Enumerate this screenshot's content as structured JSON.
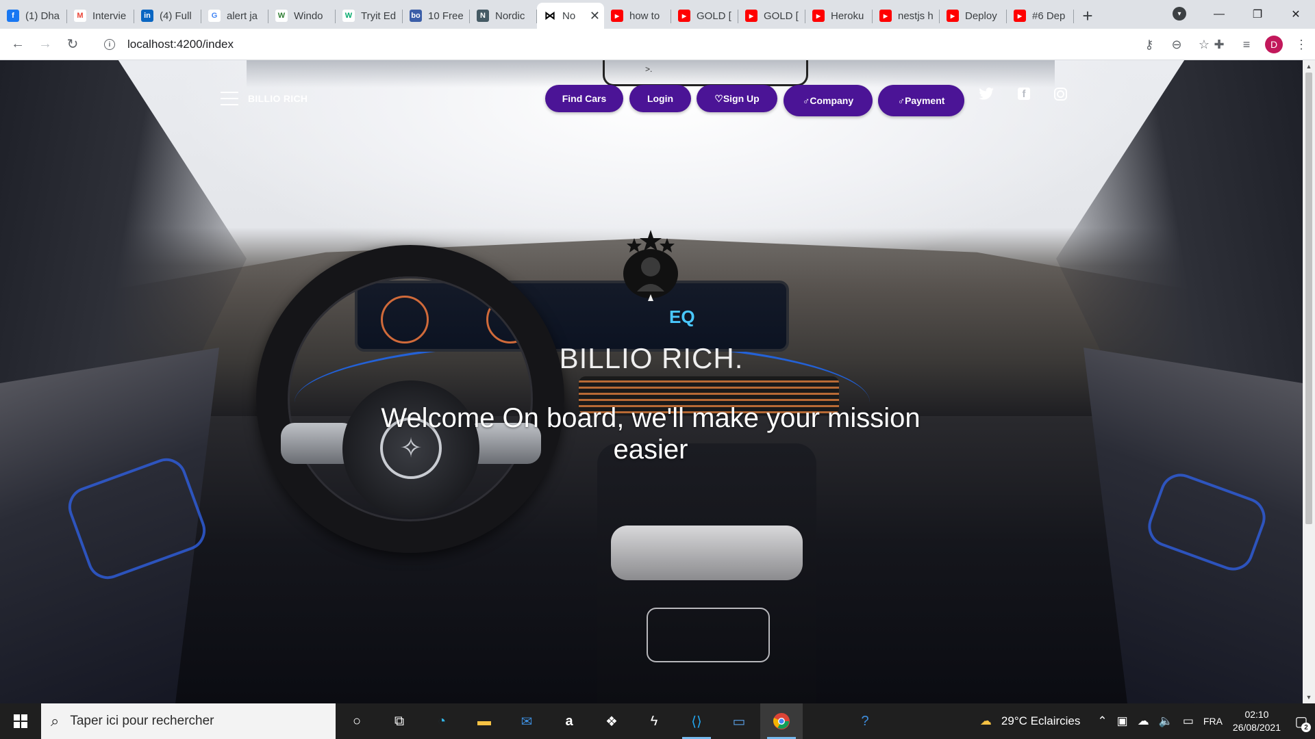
{
  "browser": {
    "tabs": [
      {
        "title": "(1) Dha",
        "icon": "facebook-icon",
        "color": "#1877f2",
        "glyph": "f"
      },
      {
        "title": "Intervie",
        "icon": "gmail-icon",
        "color": "#ea4335",
        "glyph": "M"
      },
      {
        "title": "(4) Full",
        "icon": "linkedin-icon",
        "color": "#0a66c2",
        "glyph": "in"
      },
      {
        "title": "alert ja",
        "icon": "google-icon",
        "color": "#4285f4",
        "glyph": "G"
      },
      {
        "title": "Windo",
        "icon": "w-site-icon",
        "color": "#2e7d32",
        "glyph": "W"
      },
      {
        "title": "Tryit Ed",
        "icon": "w3schools-icon",
        "color": "#04aa6d",
        "glyph": "W"
      },
      {
        "title": "10 Free",
        "icon": "bo-icon",
        "color": "#3b5ea8",
        "glyph": "bo"
      },
      {
        "title": "Nordic",
        "icon": "nordic-icon",
        "color": "#455a64",
        "glyph": "N"
      },
      {
        "title": "No",
        "icon": "bowtie-icon",
        "color": "#000000",
        "glyph": "⋈",
        "active": true
      },
      {
        "title": "how to",
        "icon": "youtube-icon",
        "color": "#ff0000",
        "glyph": "▶"
      },
      {
        "title": "GOLD [",
        "icon": "youtube-icon",
        "color": "#ff0000",
        "glyph": "▶"
      },
      {
        "title": "GOLD [",
        "icon": "youtube-icon",
        "color": "#ff0000",
        "glyph": "▶"
      },
      {
        "title": "Heroku",
        "icon": "youtube-icon",
        "color": "#ff0000",
        "glyph": "▶"
      },
      {
        "title": "nestjs h",
        "icon": "youtube-icon",
        "color": "#ff0000",
        "glyph": "▶"
      },
      {
        "title": "Deploy",
        "icon": "youtube-icon",
        "color": "#ff0000",
        "glyph": "▶"
      },
      {
        "title": "#6 Dep",
        "icon": "youtube-icon",
        "color": "#ff0000",
        "glyph": "▶"
      }
    ],
    "url": "localhost:4200/index",
    "profile_initial": "D"
  },
  "navbar": {
    "brand": "BILLIO RICH",
    "dots": ">.",
    "buttons": [
      "Find Cars",
      "Login",
      "♡Sign Up",
      "♂Company",
      "♂Payment"
    ],
    "socials": [
      "twitter-icon",
      "facebook-icon",
      "instagram-icon"
    ]
  },
  "hero": {
    "brand": "BILLIO RICH.",
    "tagline": "Welcome On board, we'll make your mission easier"
  },
  "taskbar": {
    "search_placeholder": "Taper ici pour rechercher",
    "weather": "29°C  Eclaircies",
    "language": "FRA",
    "time": "02:10",
    "date": "26/08/2021",
    "notifications": "2"
  },
  "colors": {
    "accent": "#4b1496"
  }
}
